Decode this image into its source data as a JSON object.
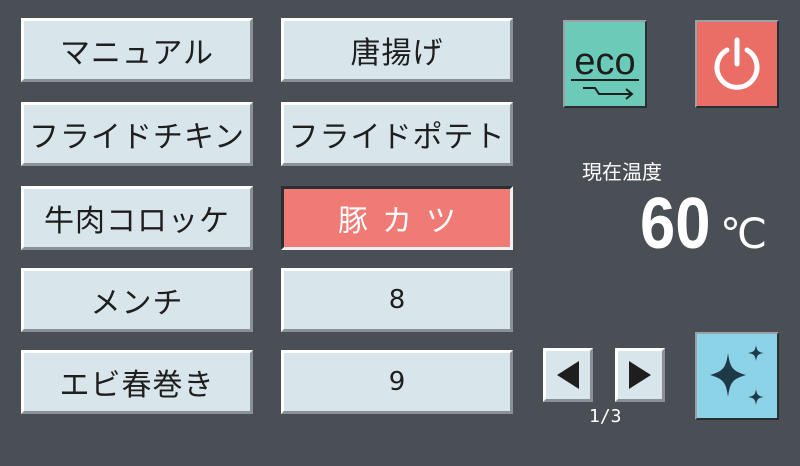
{
  "menu_left": [
    {
      "label": "マニュアル"
    },
    {
      "label": "フライドチキン"
    },
    {
      "label": "牛肉コロッケ"
    },
    {
      "label": "メンチ"
    },
    {
      "label": "エビ春巻き"
    }
  ],
  "menu_right": [
    {
      "label": "唐揚げ"
    },
    {
      "label": "フライドポテト"
    },
    {
      "label": "豚カツ",
      "selected": true
    },
    {
      "label": "8"
    },
    {
      "label": "9"
    }
  ],
  "eco_button": {
    "label": "eco",
    "color": "#6ccab8"
  },
  "power_button": {
    "icon": "power-icon",
    "color": "#ea6e65"
  },
  "temperature": {
    "label": "現在温度",
    "value": "60",
    "unit": "℃"
  },
  "pagination": {
    "current": "1/3"
  },
  "clean_button": {
    "icon": "sparkle-icon",
    "color": "#8dd3e8"
  },
  "colors": {
    "background": "#4a4f55",
    "button": "#d8e6ec",
    "selected": "#ef7b74"
  }
}
